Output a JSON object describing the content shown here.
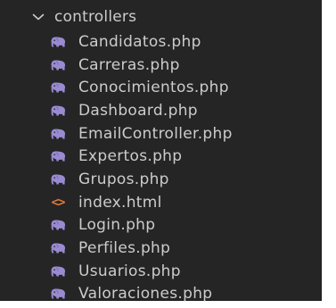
{
  "explorer": {
    "folder": {
      "name": "controllers",
      "expanded": true,
      "icon": "chevron-down-icon"
    },
    "files": [
      {
        "name": "Candidatos.php",
        "icon": "php-elephant-icon"
      },
      {
        "name": "Carreras.php",
        "icon": "php-elephant-icon"
      },
      {
        "name": "Conocimientos.php",
        "icon": "php-elephant-icon"
      },
      {
        "name": "Dashboard.php",
        "icon": "php-elephant-icon"
      },
      {
        "name": "EmailController.php",
        "icon": "php-elephant-icon"
      },
      {
        "name": "Expertos.php",
        "icon": "php-elephant-icon"
      },
      {
        "name": "Grupos.php",
        "icon": "php-elephant-icon"
      },
      {
        "name": "index.html",
        "icon": "html-icon"
      },
      {
        "name": "Login.php",
        "icon": "php-elephant-icon"
      },
      {
        "name": "Perfiles.php",
        "icon": "php-elephant-icon"
      },
      {
        "name": "Usuarios.php",
        "icon": "php-elephant-icon"
      },
      {
        "name": "Valoraciones.php",
        "icon": "php-elephant-icon"
      }
    ],
    "colors": {
      "background": "#252526",
      "text": "#cccccc",
      "php_icon": "#9a8bd0",
      "html_icon": "#e37933"
    }
  }
}
